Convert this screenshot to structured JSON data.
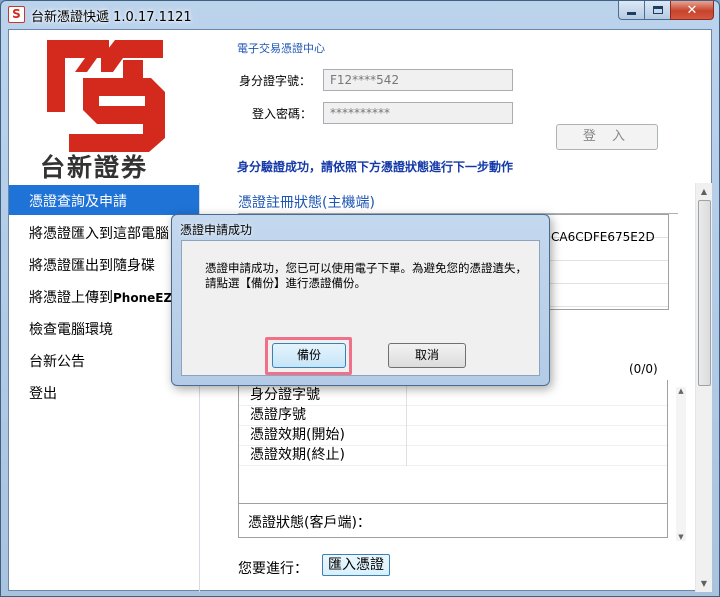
{
  "window": {
    "title": "台新憑證快遞 1.0.17.1121",
    "app_icon_glyph": "S",
    "close_glyph": "✕"
  },
  "header": {
    "logo_text": "台新證券",
    "center_title": "電子交易憑證中心",
    "id_label": "身分證字號：",
    "id_value": "F12****542",
    "password_label": "登入密碼：",
    "password_value": "**********",
    "login_button": "登 入",
    "success_message": "身分驗證成功，請依照下方憑證狀態進行下一步動作"
  },
  "sidebar": {
    "items": [
      {
        "label": "憑證查詢及申請",
        "active": true
      },
      {
        "label": "將憑證匯入到這部電腦",
        "active": false
      },
      {
        "label": "將憑證匯出到隨身碟",
        "active": false
      },
      {
        "label_zh": "將憑證上傳到",
        "label_en": "PhoneEZ",
        "active": false
      },
      {
        "label": "檢查電腦環境",
        "active": false
      },
      {
        "label": "台新公告",
        "active": false
      },
      {
        "label": "登出",
        "active": false
      }
    ]
  },
  "main": {
    "section_title": "憑證註冊狀態(主機端)",
    "host_code": "CA6CDFE675E2D",
    "count": "(0/0)",
    "info_rows": [
      "身分證字號",
      "憑證序號",
      "憑證效期(開始)",
      "憑證效期(終止)"
    ],
    "client_status_label": "憑證狀態(客戶端)：",
    "todo_label": "您要進行：",
    "import_button": "匯入憑證"
  },
  "dialog": {
    "title": "憑證申請成功",
    "message": "憑證申請成功，您已可以使用電子下單。為避免您的憑證遺失，請點選【備份】進行憑證備份。",
    "backup_button": "備份",
    "cancel_button": "取消"
  },
  "colors": {
    "accent_blue": "#1f73d6",
    "title_blue": "#1e56b4",
    "logo_red": "#d42a1e",
    "highlight_pink": "#f0708a"
  }
}
